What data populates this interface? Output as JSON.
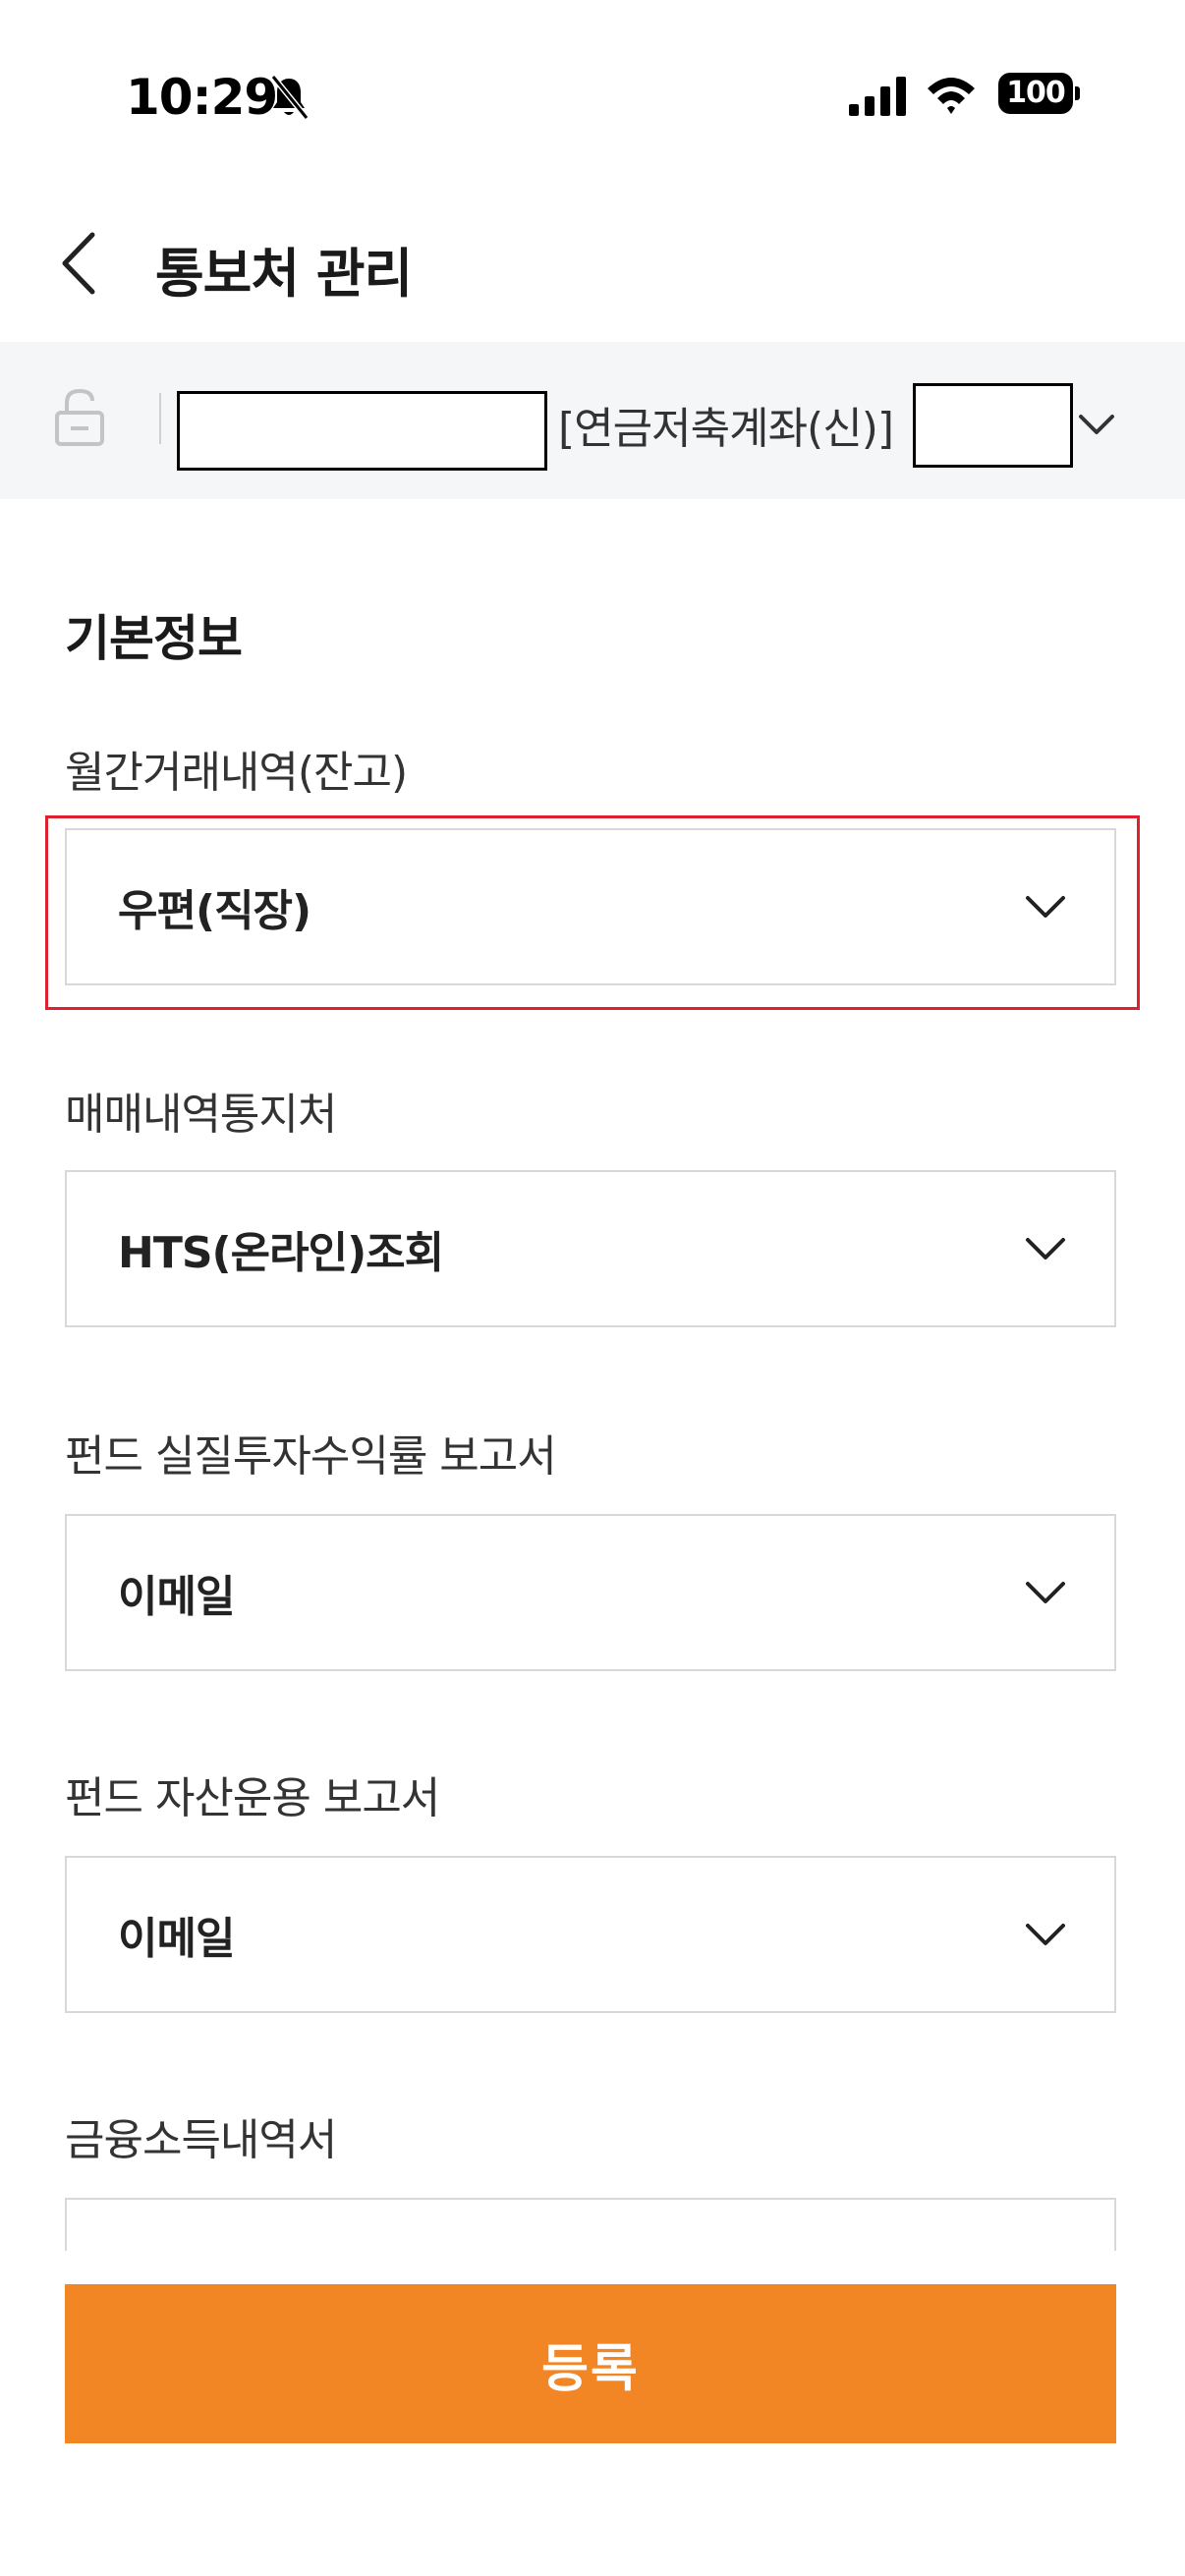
{
  "status_bar": {
    "time": "10:29",
    "battery": "100",
    "icons": [
      "bell-slash-icon",
      "cellular-signal-icon",
      "wifi-icon",
      "battery-icon"
    ]
  },
  "header": {
    "title": "통보처 관리",
    "back_icon": "chevron-left-icon"
  },
  "account": {
    "lock_icon": "unlock-icon",
    "type_label": "[연금저축계좌(신)]",
    "dropdown_icon": "chevron-down-icon"
  },
  "section": {
    "title": "기본정보"
  },
  "fields": [
    {
      "label": "월간거래내역(잔고)",
      "value": "우편(직장)"
    },
    {
      "label": "매매내역통지처",
      "value": "HTS(온라인)조회"
    },
    {
      "label": "펀드 실질투자수익률 보고서",
      "value": "이메일"
    },
    {
      "label": "펀드 자산운용 보고서",
      "value": "이메일"
    },
    {
      "label": "금융소득내역서",
      "value": ""
    }
  ],
  "submit": {
    "label": "등록"
  },
  "colors": {
    "accent": "#f28524",
    "highlight": "#e0202f",
    "account_bar_bg": "#f5f6f8",
    "border": "#d8d8d8"
  }
}
